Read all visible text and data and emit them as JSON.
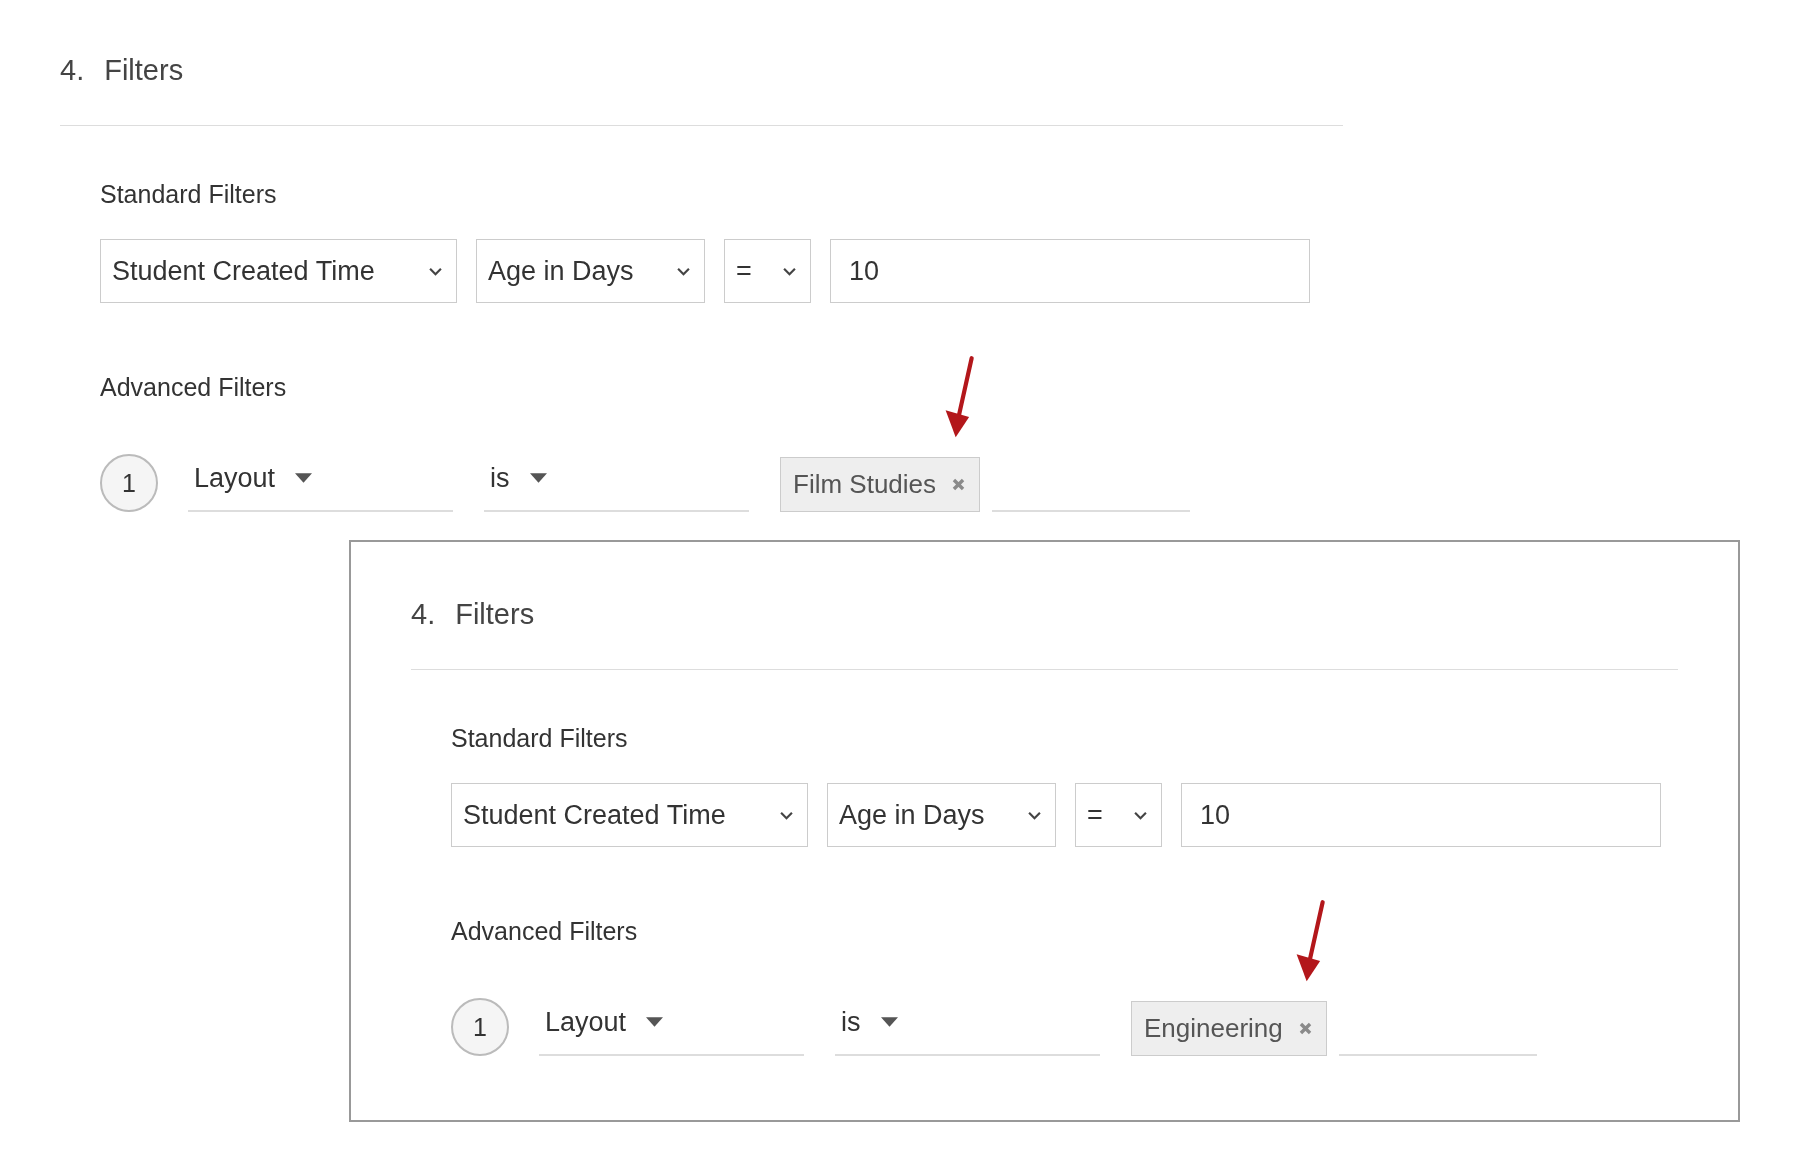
{
  "panels": [
    {
      "framed": false,
      "heading": {
        "number": "4.",
        "title": "Filters"
      },
      "standard_filters": {
        "label": "Standard Filters",
        "selects": [
          "Student Created Time",
          "Age in Days",
          "="
        ],
        "value": "10"
      },
      "advanced_filters": {
        "label": "Advanced Filters",
        "rows": [
          {
            "number": "1",
            "field": "Layout",
            "operator": "is",
            "tags": [
              "Film Studies"
            ]
          }
        ]
      }
    },
    {
      "framed": true,
      "heading": {
        "number": "4.",
        "title": "Filters"
      },
      "standard_filters": {
        "label": "Standard Filters",
        "selects": [
          "Student Created Time",
          "Age in Days",
          "="
        ],
        "value": "10"
      },
      "advanced_filters": {
        "label": "Advanced Filters",
        "rows": [
          {
            "number": "1",
            "field": "Layout",
            "operator": "is",
            "tags": [
              "Engineering"
            ]
          }
        ]
      }
    }
  ]
}
